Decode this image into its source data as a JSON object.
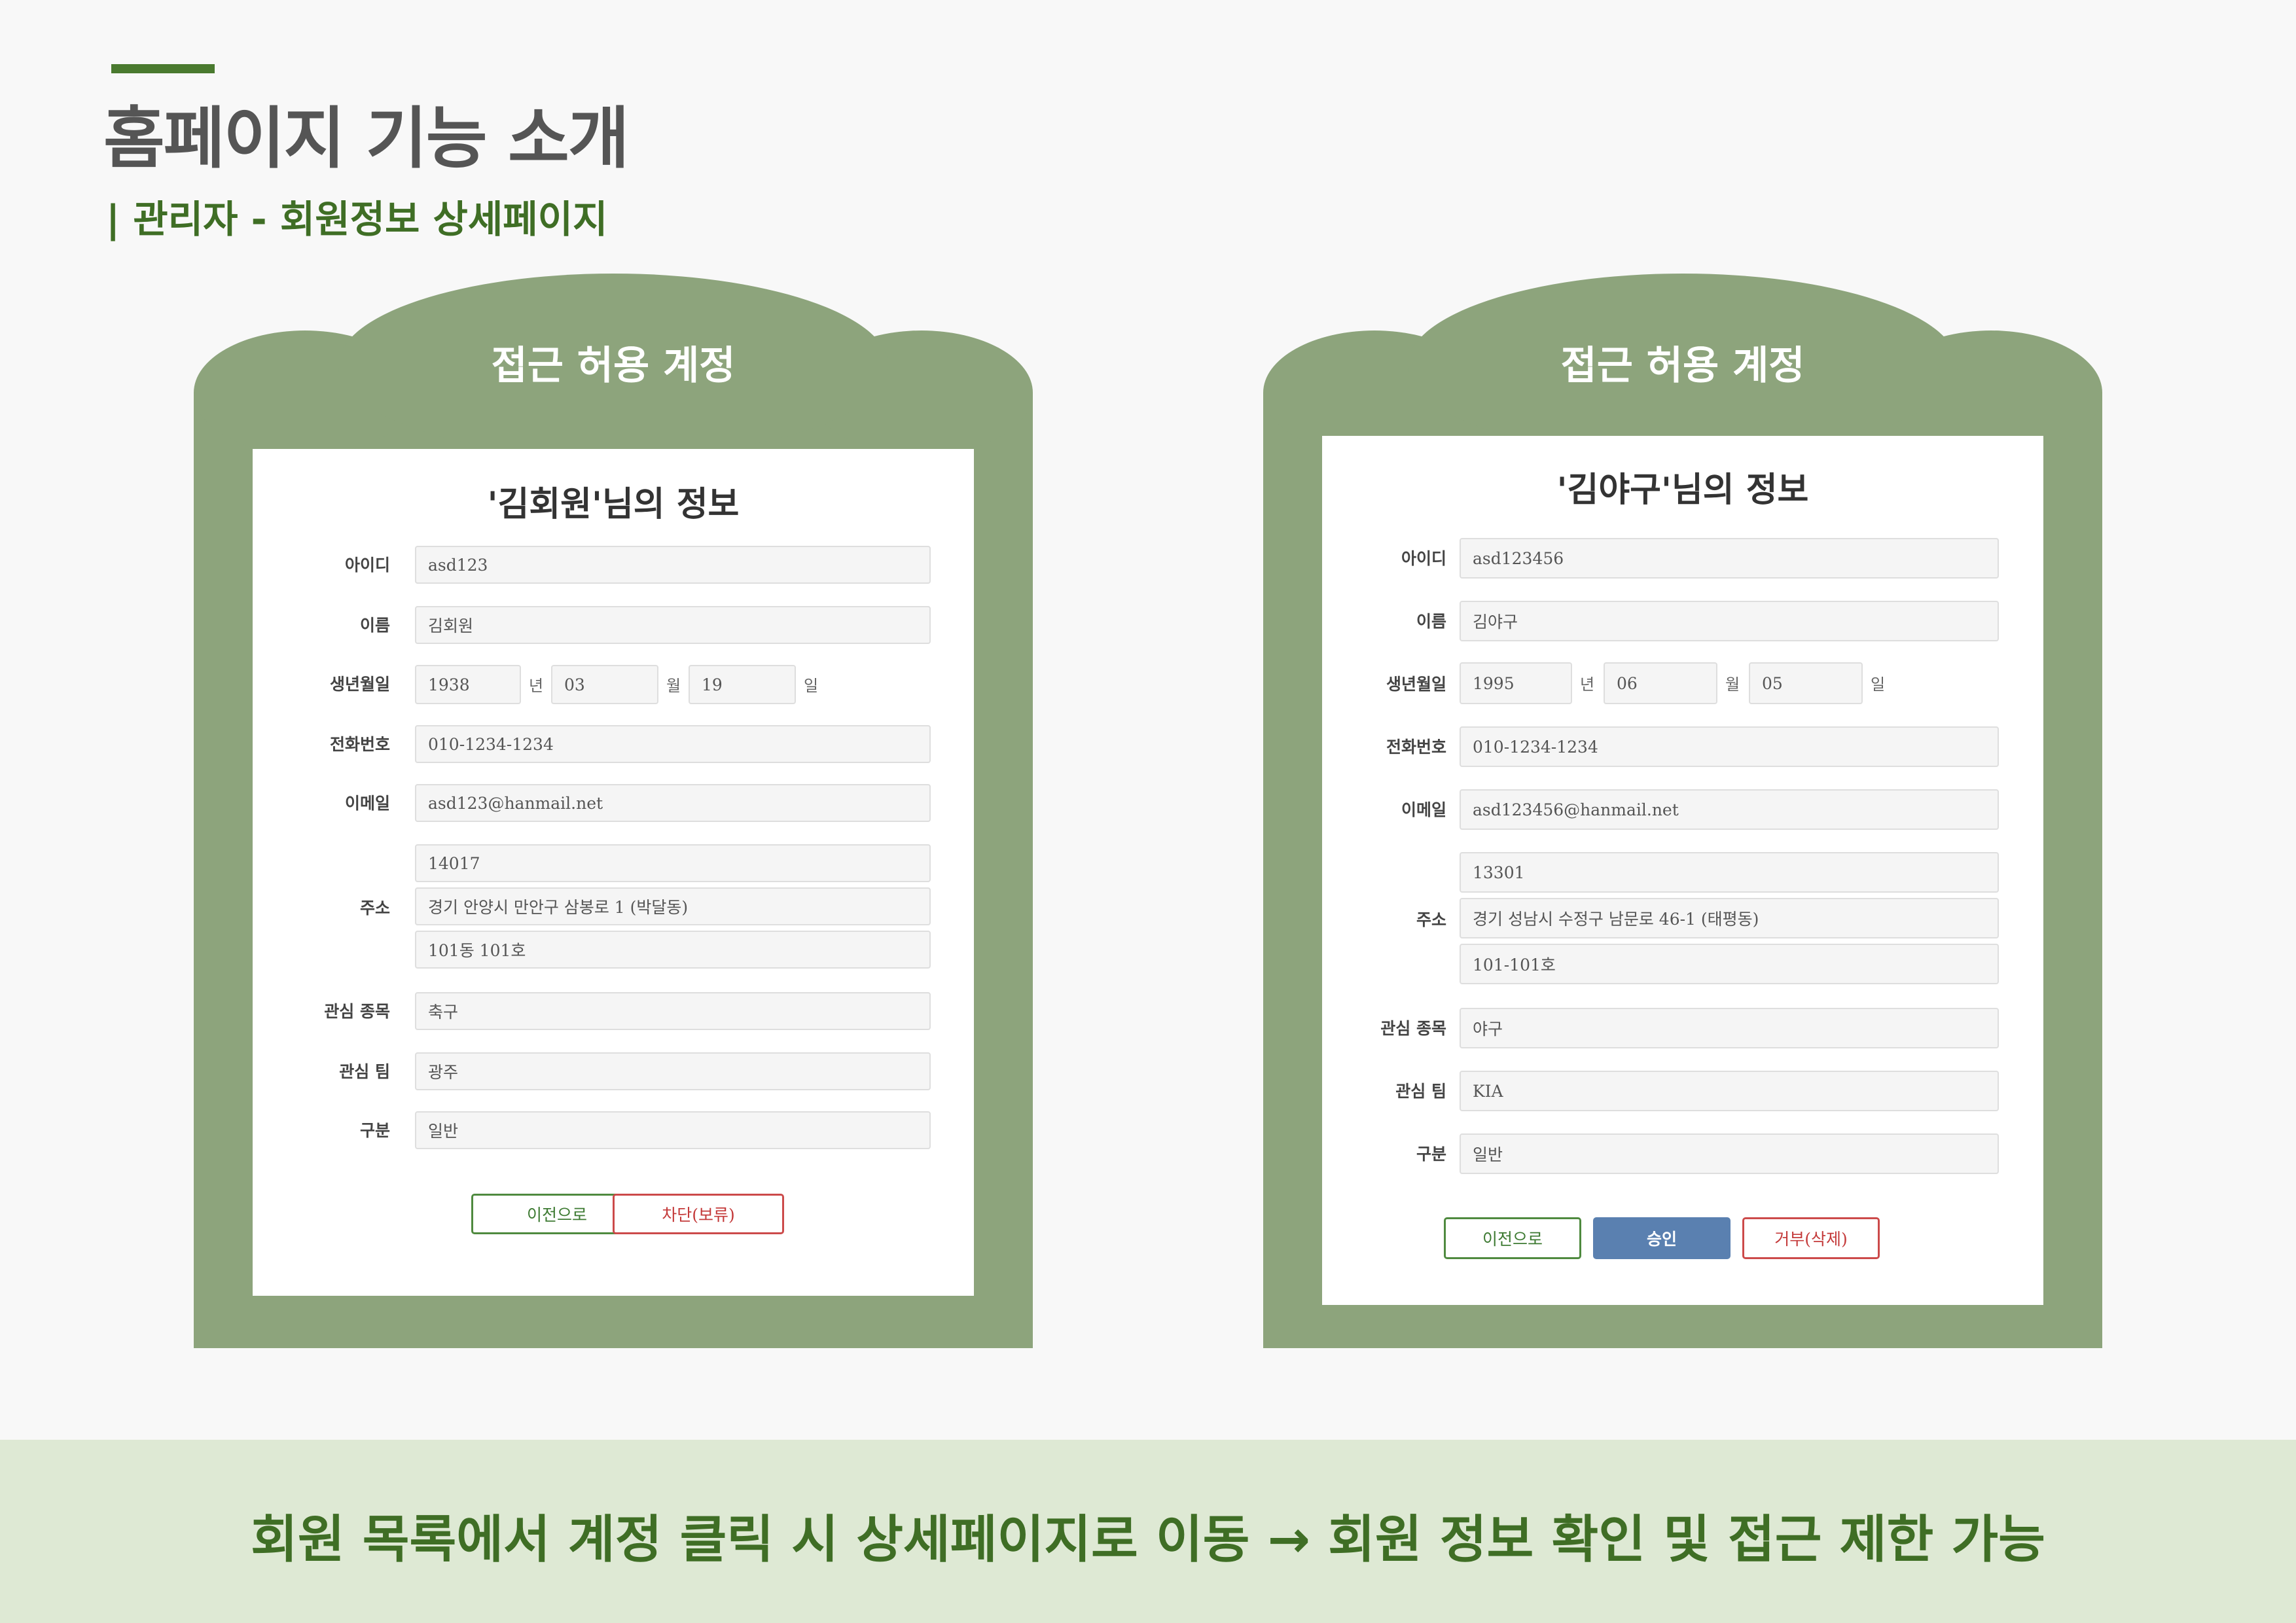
{
  "header": {
    "title": "홈페이지 기능 소개",
    "subtitle": "| 관리자 - 회원정보 상세페이지"
  },
  "colors": {
    "frame": "#8da47c",
    "accent": "#4a7a2f",
    "footer_bg": "#dee9d4",
    "approve_button": "#5a80b0"
  },
  "panels": [
    {
      "banner": "접근 허용 계정",
      "card_title": "'김회원'님의 정보",
      "labels": {
        "id": "아이디",
        "name": "이름",
        "birth": "생년월일",
        "phone": "전화번호",
        "email": "이메일",
        "address": "주소",
        "sport": "관심 종목",
        "team": "관심 팀",
        "category": "구분"
      },
      "values": {
        "id": "asd123",
        "name": "김회원",
        "birth_year": "1938",
        "birth_month": "03",
        "birth_day": "19",
        "phone": "010-1234-1234",
        "email": "asd123@hanmail.net",
        "zipcode": "14017",
        "address1": "경기 안양시 만안구 삼봉로 1 (박달동)",
        "address2": "101동 101호",
        "sport": "축구",
        "team": "광주",
        "category": "일반"
      },
      "units": {
        "year": "년",
        "month": "월",
        "day": "일"
      },
      "buttons": {
        "back": "이전으로",
        "block": "차단(보류)"
      }
    },
    {
      "banner": "접근 허용 계정",
      "card_title": "'김야구'님의 정보",
      "labels": {
        "id": "아이디",
        "name": "이름",
        "birth": "생년월일",
        "phone": "전화번호",
        "email": "이메일",
        "address": "주소",
        "sport": "관심 종목",
        "team": "관심 팀",
        "category": "구분"
      },
      "values": {
        "id": "asd123456",
        "name": "김야구",
        "birth_year": "1995",
        "birth_month": "06",
        "birth_day": "05",
        "phone": "010-1234-1234",
        "email": "asd123456@hanmail.net",
        "zipcode": "13301",
        "address1": "경기 성남시 수정구 남문로 46-1 (태평동)",
        "address2": "101-101호",
        "sport": "야구",
        "team": "KIA",
        "category": "일반"
      },
      "units": {
        "year": "년",
        "month": "월",
        "day": "일"
      },
      "buttons": {
        "back": "이전으로",
        "approve": "승인",
        "reject": "거부(삭제)"
      }
    }
  ],
  "footer": {
    "text": "회원 목록에서 계정 클릭 시 상세페이지로 이동 → 회원 정보 확인 및 접근 제한 가능"
  }
}
